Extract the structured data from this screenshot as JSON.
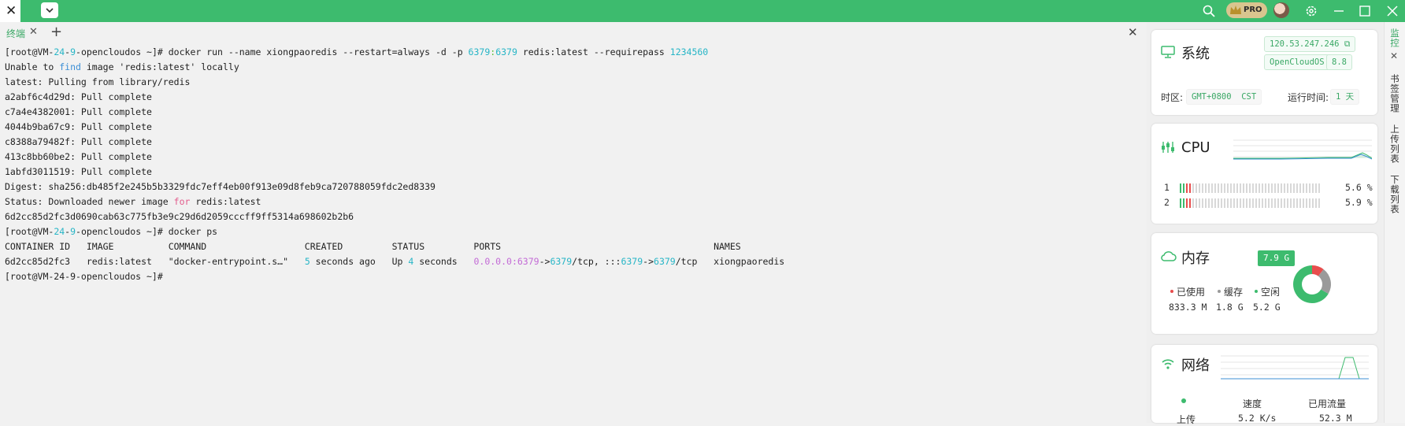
{
  "tab": {
    "label": "终端"
  },
  "terminal_lines": [
    [
      {
        "t": "[root@VM-"
      },
      {
        "t": "24",
        "c": "c-cy"
      },
      {
        "t": "-"
      },
      {
        "t": "9",
        "c": "c-cy"
      },
      {
        "t": "-opencloudos ~]# docker run --name xiongpaoredis --restart=always -d -p "
      },
      {
        "t": "6379",
        "c": "c-cy"
      },
      {
        "t": ":",
        "c": "c-gr"
      },
      {
        "t": "6379",
        "c": "c-cy"
      },
      {
        "t": " redis:latest --requirepass "
      },
      {
        "t": "1234560",
        "c": "c-cy"
      }
    ],
    [
      {
        "t": "Unable to "
      },
      {
        "t": "find",
        "c": "c-bl"
      },
      {
        "t": " image 'redis:latest' locally"
      }
    ],
    [
      {
        "t": "latest: Pulling from library/redis"
      }
    ],
    [
      {
        "t": "a2abf6c4d29d: Pull complete"
      }
    ],
    [
      {
        "t": "c7a4e4382001: Pull complete"
      }
    ],
    [
      {
        "t": "4044b9ba67c9: Pull complete"
      }
    ],
    [
      {
        "t": "c8388a79482f: Pull complete"
      }
    ],
    [
      {
        "t": "413c8bb60be2: Pull complete"
      }
    ],
    [
      {
        "t": "1abfd3011519: Pull complete"
      }
    ],
    [
      {
        "t": "Digest: sha256:db485f2e245b5b3329fdc7eff4eb00f913e09d8feb9ca720788059fdc2ed8339"
      }
    ],
    [
      {
        "t": "Status: Downloaded newer image "
      },
      {
        "t": "for",
        "c": "c-pk"
      },
      {
        "t": " redis:latest"
      }
    ],
    [
      {
        "t": "6d2cc85d2fc3d0690cab63c775fb3e9c29d6d2059cccff9ff5314a698602b2b6"
      }
    ],
    [
      {
        "t": "[root@VM-"
      },
      {
        "t": "24",
        "c": "c-cy"
      },
      {
        "t": "-"
      },
      {
        "t": "9",
        "c": "c-cy"
      },
      {
        "t": "-opencloudos ~]# docker ps"
      }
    ],
    [
      {
        "t": "CONTAINER ID   IMAGE          COMMAND                  CREATED         STATUS         PORTS                                       NAMES"
      }
    ],
    [
      {
        "t": "6d2cc85d2fc3   redis:latest   \"docker-entrypoint.s…\"   "
      },
      {
        "t": "5",
        "c": "c-cy"
      },
      {
        "t": " seconds ago   Up "
      },
      {
        "t": "4",
        "c": "c-cy"
      },
      {
        "t": " seconds   "
      },
      {
        "t": "0.0.0.0:6379",
        "c": "c-mg"
      },
      {
        "t": "->"
      },
      {
        "t": "6379",
        "c": "c-cy"
      },
      {
        "t": "/tcp, :::"
      },
      {
        "t": "6379",
        "c": "c-cy"
      },
      {
        "t": "->"
      },
      {
        "t": "6379",
        "c": "c-cy"
      },
      {
        "t": "/tcp   xiongpaoredis"
      }
    ],
    [
      {
        "t": "[root@VM-24-9-opencloudos ~]#"
      }
    ]
  ],
  "system": {
    "title": "系统",
    "ip": "120.53.247.246",
    "os": "OpenCloudOS",
    "os_version": "8.8",
    "timezone_label": "时区:",
    "timezone_gmt": "GMT+0800",
    "timezone_name": "CST",
    "uptime_label": "运行时间:",
    "uptime_value": "1 天"
  },
  "cpu": {
    "title": "CPU",
    "cores": [
      {
        "id": "1",
        "percent": "5.6 %",
        "active_bars": 4
      },
      {
        "id": "2",
        "percent": "5.9 %",
        "active_bars": 4
      }
    ]
  },
  "memory": {
    "title": "内存",
    "total": "7.9 G",
    "legend": [
      {
        "label": "已使用",
        "value": "833.3 M",
        "color": "#e84d4d"
      },
      {
        "label": "缓存",
        "value": "1.8 G",
        "color": "#9a9a9a"
      },
      {
        "label": "空闲",
        "value": "5.2 G",
        "color": "#3dbb6e"
      }
    ]
  },
  "network": {
    "title": "网络",
    "speed_label": "速度",
    "used_label": "已用流量",
    "upload_label": "上传",
    "upload_speed": "5.2 K/s",
    "upload_used": "52.3 M"
  },
  "side_tabs": [
    "监控",
    "书签管理",
    "上传列表",
    "下载列表"
  ],
  "colors": {
    "accent": "#3dbb6e",
    "terminal_cyan": "#26b5c6",
    "terminal_magenta": "#c36ad6"
  }
}
